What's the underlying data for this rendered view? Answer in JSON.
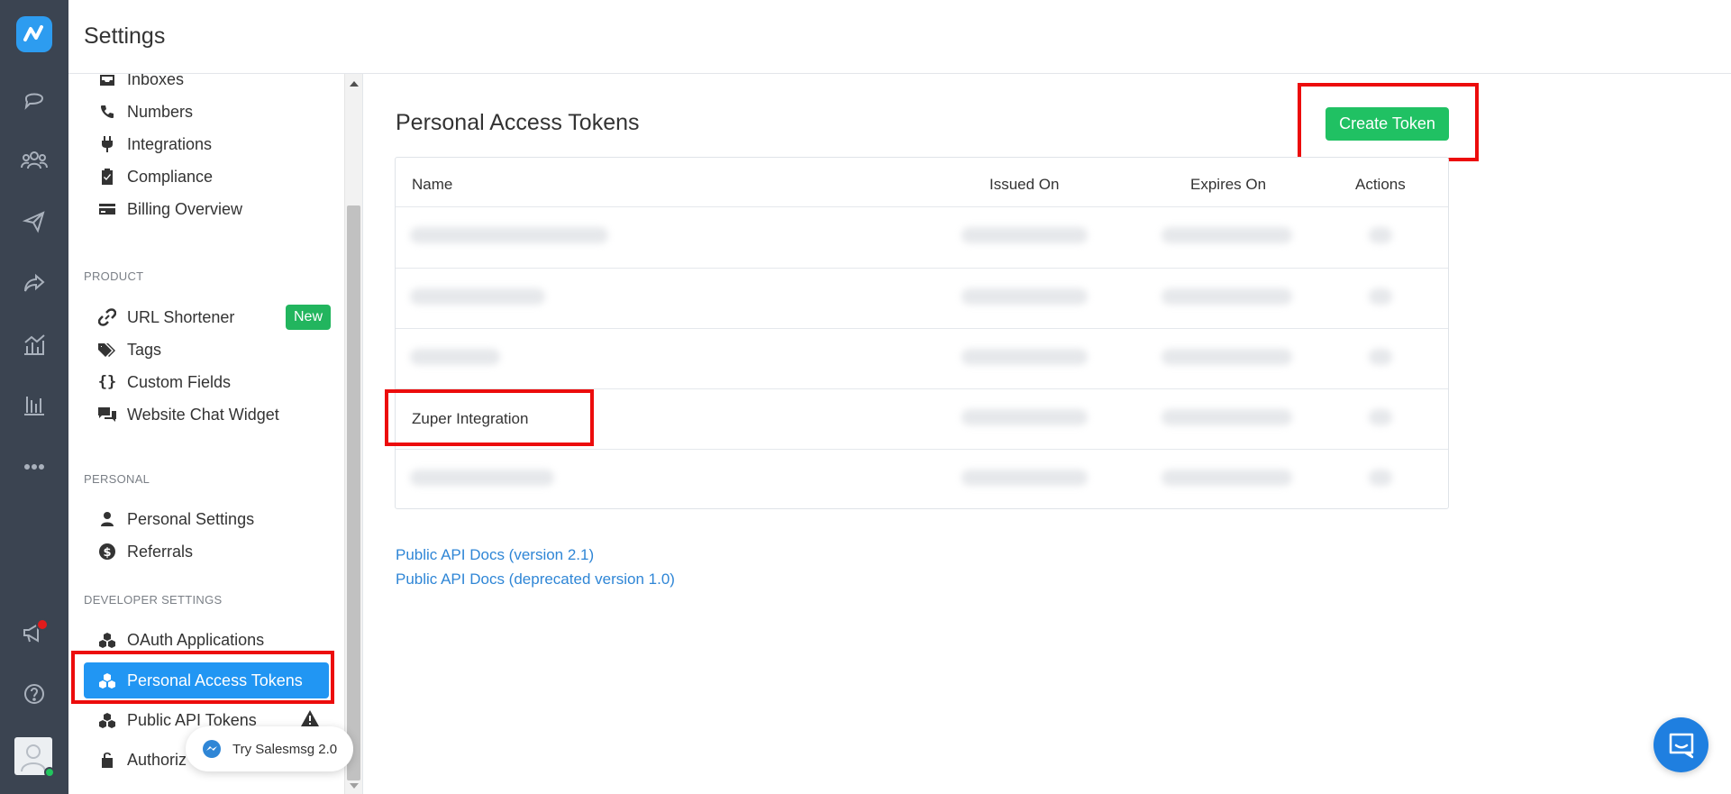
{
  "header": {
    "title": "Settings"
  },
  "sidebar": {
    "items_top": [
      {
        "label": "Inboxes",
        "icon": "inbox-icon"
      },
      {
        "label": "Numbers",
        "icon": "phone-icon"
      },
      {
        "label": "Integrations",
        "icon": "plug-icon"
      },
      {
        "label": "Compliance",
        "icon": "clipboard-check-icon"
      },
      {
        "label": "Billing Overview",
        "icon": "credit-card-icon"
      }
    ],
    "sections": {
      "product": "PRODUCT",
      "personal": "PERSONAL",
      "developer": "DEVELOPER SETTINGS"
    },
    "product_items": [
      {
        "label": "URL Shortener",
        "icon": "link-icon",
        "badge": "New"
      },
      {
        "label": "Tags",
        "icon": "tags-icon"
      },
      {
        "label": "Custom Fields",
        "icon": "braces-icon"
      },
      {
        "label": "Website Chat Widget",
        "icon": "chat-widget-icon"
      }
    ],
    "personal_items": [
      {
        "label": "Personal Settings",
        "icon": "user-icon"
      },
      {
        "label": "Referrals",
        "icon": "dollar-icon"
      }
    ],
    "developer_items": [
      {
        "label": "OAuth Applications",
        "icon": "cubes-icon"
      },
      {
        "label": "Personal Access Tokens",
        "icon": "cubes-icon",
        "active": true
      },
      {
        "label": "Public API Tokens",
        "icon": "cubes-icon",
        "warning": true
      },
      {
        "label": "Authoriz",
        "icon": "unlock-icon"
      }
    ]
  },
  "try_pill": {
    "label": "Try Salesmsg 2.0"
  },
  "main": {
    "title": "Personal Access Tokens",
    "create_button": "Create Token",
    "table": {
      "headers": {
        "name": "Name",
        "issued": "Issued On",
        "expires": "Expires On",
        "actions": "Actions"
      },
      "rows": [
        {
          "name": ""
        },
        {
          "name": ""
        },
        {
          "name": ""
        },
        {
          "name": "Zuper Integration"
        },
        {
          "name": ""
        }
      ]
    },
    "links": [
      "Public API Docs (version 2.1)",
      "Public API Docs (deprecated version 1.0)"
    ]
  },
  "colors": {
    "rail": "#3b4451",
    "accent_blue": "#2196f3",
    "create_green": "#20c163",
    "highlight_red": "#ec0c0c",
    "link_blue": "#2f86d6"
  }
}
